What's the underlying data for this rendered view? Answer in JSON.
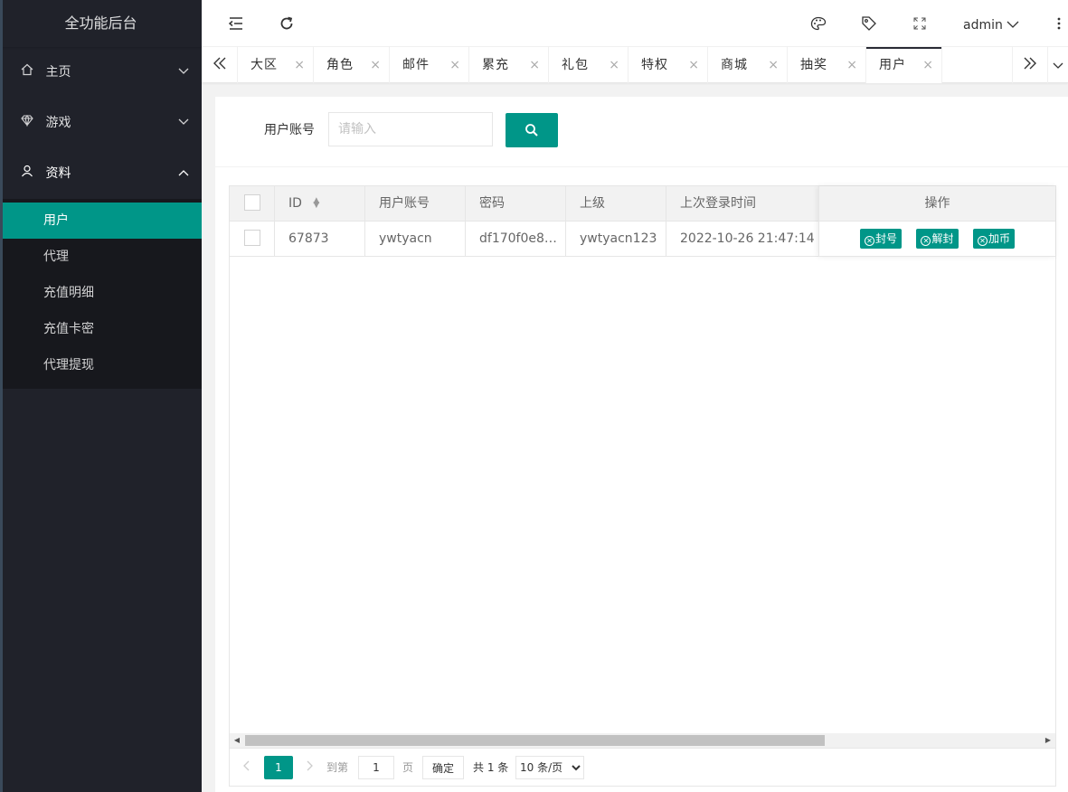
{
  "app": {
    "title": "全功能后台"
  },
  "sidebar": {
    "groups": [
      {
        "label": "主页",
        "icon": "home-icon",
        "chevron": "▽"
      },
      {
        "label": "游戏",
        "icon": "diamond-icon",
        "chevron": "▽"
      },
      {
        "label": "资料",
        "icon": "user-icon",
        "chevron": "△"
      }
    ],
    "sub_items": [
      "用户",
      "代理",
      "充值明细",
      "充值卡密",
      "代理提现"
    ],
    "active_sub": "用户"
  },
  "header": {
    "user": "admin",
    "icons": [
      "shrink-icon",
      "refresh-icon",
      "theme-icon",
      "tag-icon",
      "fullscreen-icon",
      "more-icon"
    ]
  },
  "tabs": {
    "items": [
      "大区",
      "角色",
      "邮件",
      "累充",
      "礼包",
      "特权",
      "商城",
      "抽奖",
      "用户"
    ],
    "active": "用户",
    "close": "×"
  },
  "search": {
    "label": "用户账号",
    "placeholder": "请输入",
    "value": ""
  },
  "table": {
    "columns": [
      "ID",
      "用户账号",
      "密码",
      "上级",
      "上次登录时间",
      "操作"
    ],
    "rows": [
      {
        "id": "67873",
        "account": "ywtyacn",
        "password": "df170f0e8…",
        "parent": "ywtyacn123",
        "last_login": "2022-10-26 21:47:14"
      }
    ],
    "actions": [
      "封号",
      "解封",
      "加币"
    ]
  },
  "pager": {
    "current": "1",
    "goto_label": "到第",
    "goto_value": "1",
    "page_unit": "页",
    "confirm": "确定",
    "total": "共 1 条",
    "page_size": "10 条/页"
  },
  "colors": {
    "accent": "#009688",
    "sidebar_bg": "#20222a"
  }
}
